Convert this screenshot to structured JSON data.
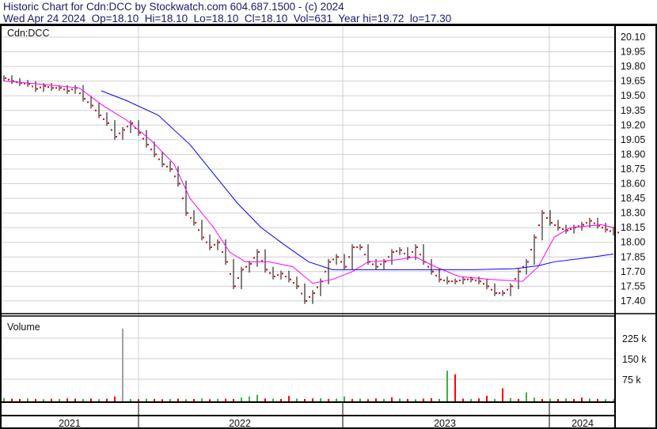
{
  "header": {
    "title": "Historic Chart for Cdn:DCC by Stockwatch.com 604.687.1500 - (c) 2024",
    "quote": "Wed Apr 24 2024  Op=18.10  Hi=18.10  Lo=18.10  Cl=18.10  Vol=631  Year hi=19.72  lo=17.30"
  },
  "chart_data": {
    "type": "line",
    "title": "Cdn:DCC",
    "price_axis": {
      "ticks": [
        20.1,
        19.95,
        19.8,
        19.65,
        19.5,
        19.35,
        19.2,
        19.05,
        18.9,
        18.75,
        18.6,
        18.45,
        18.3,
        18.15,
        18.0,
        17.85,
        17.7,
        17.55,
        17.4
      ],
      "range": [
        17.3,
        20.22
      ]
    },
    "x_axis": {
      "labels": [
        "2021",
        "2022",
        "2023",
        "2024"
      ],
      "range": [
        "2021-04",
        "2024-04"
      ]
    },
    "closes": [
      19.68,
      19.65,
      19.63,
      19.62,
      19.57,
      19.6,
      19.58,
      19.58,
      19.55,
      19.58,
      19.47,
      19.4,
      19.3,
      19.22,
      19.08,
      19.15,
      19.22,
      19.12,
      19.0,
      18.9,
      18.8,
      18.75,
      18.6,
      18.3,
      18.2,
      18.05,
      17.95,
      18.0,
      17.8,
      17.55,
      17.72,
      17.78,
      17.9,
      17.72,
      17.65,
      17.68,
      17.62,
      17.55,
      17.4,
      17.48,
      17.6,
      17.8,
      17.85,
      17.75,
      17.95,
      17.95,
      17.8,
      17.75,
      17.8,
      17.9,
      17.92,
      17.85,
      17.95,
      17.8,
      17.7,
      17.62,
      17.6,
      17.6,
      17.62,
      17.62,
      17.6,
      17.55,
      17.48,
      17.48,
      17.55,
      17.7,
      17.8,
      18.05,
      18.3,
      18.2,
      18.15,
      18.12,
      18.15,
      18.18,
      18.22,
      18.17,
      18.13,
      18.1
    ],
    "ma_short": {
      "color": "#ff00ff",
      "points": [
        [
          0,
          19.65
        ],
        [
          4.5,
          19.62
        ],
        [
          9.5,
          19.58
        ],
        [
          12.5,
          19.4
        ],
        [
          15.5,
          19.25
        ],
        [
          18.5,
          19.05
        ],
        [
          21.5,
          18.8
        ],
        [
          23.5,
          18.45
        ],
        [
          26.5,
          18.15
        ],
        [
          28.5,
          17.9
        ],
        [
          30.5,
          17.8
        ],
        [
          33.5,
          17.8
        ],
        [
          36.5,
          17.75
        ],
        [
          39,
          17.58
        ],
        [
          41.5,
          17.62
        ],
        [
          44,
          17.7
        ],
        [
          46,
          17.8
        ],
        [
          49.5,
          17.82
        ],
        [
          52,
          17.85
        ],
        [
          54.5,
          17.75
        ],
        [
          57.5,
          17.65
        ],
        [
          61.5,
          17.62
        ],
        [
          65.5,
          17.6
        ],
        [
          67.5,
          17.75
        ],
        [
          69.5,
          18.05
        ],
        [
          71.5,
          18.15
        ],
        [
          75.5,
          18.18
        ],
        [
          77,
          18.15
        ]
      ]
    },
    "ma_long": {
      "color": "#0000ff",
      "points": [
        [
          12.3,
          19.55
        ],
        [
          15.5,
          19.45
        ],
        [
          19.5,
          19.3
        ],
        [
          23.5,
          19.0
        ],
        [
          26.5,
          18.7
        ],
        [
          29.5,
          18.4
        ],
        [
          32.5,
          18.15
        ],
        [
          35.5,
          17.97
        ],
        [
          38.5,
          17.8
        ],
        [
          41.5,
          17.72
        ],
        [
          44.5,
          17.72
        ],
        [
          49.5,
          17.72
        ],
        [
          54.5,
          17.72
        ],
        [
          59.5,
          17.72
        ],
        [
          64.5,
          17.73
        ],
        [
          67.5,
          17.76
        ],
        [
          69.5,
          17.8
        ],
        [
          73.5,
          17.84
        ],
        [
          77,
          17.88
        ]
      ]
    },
    "volume": {
      "label": "Volume",
      "ticks": [
        {
          "v": 225000,
          "t": "225 k"
        },
        {
          "v": 150000,
          "t": "150 k"
        },
        {
          "v": 75000,
          "t": "75 k"
        }
      ],
      "values": [
        6000,
        4000,
        3000,
        5000,
        3000,
        2000,
        4000,
        3000,
        5000,
        4000,
        3000,
        5000,
        2000,
        4000,
        12000,
        260000,
        3000,
        2000,
        4000,
        3000,
        2000,
        3000,
        4000,
        2000,
        3000,
        5000,
        2000,
        3000,
        4000,
        3000,
        8000,
        12000,
        18000,
        5000,
        4000,
        3000,
        14000,
        4000,
        3000,
        5000,
        6000,
        3000,
        4000,
        12000,
        3000,
        4000,
        2000,
        5000,
        3000,
        9000,
        4000,
        3000,
        2000,
        4000,
        6000,
        3000,
        106000,
        93000,
        4000,
        3000,
        5000,
        14000,
        3000,
        42000,
        6000,
        3000,
        27000,
        8000,
        3000,
        4000,
        3000,
        5000,
        3000,
        8000,
        4000,
        3000,
        2000,
        2000
      ],
      "colors": [
        "g",
        "r",
        "r",
        "g",
        "r",
        "g",
        "r",
        "g",
        "r",
        "r",
        "g",
        "r",
        "g",
        "r",
        "r",
        "x",
        "g",
        "r",
        "g",
        "r",
        "r",
        "g",
        "r",
        "g",
        "r",
        "g",
        "r",
        "g",
        "r",
        "r",
        "g",
        "g",
        "g",
        "r",
        "g",
        "r",
        "r",
        "g",
        "r",
        "r",
        "g",
        "r",
        "g",
        "g",
        "r",
        "g",
        "r",
        "r",
        "g",
        "r",
        "g",
        "r",
        "g",
        "r",
        "r",
        "g",
        "g",
        "r",
        "r",
        "g",
        "r",
        "r",
        "g",
        "r",
        "g",
        "r",
        "g",
        "g",
        "r",
        "g",
        "r",
        "g",
        "r",
        "r",
        "g",
        "r",
        "g",
        "x"
      ]
    }
  }
}
